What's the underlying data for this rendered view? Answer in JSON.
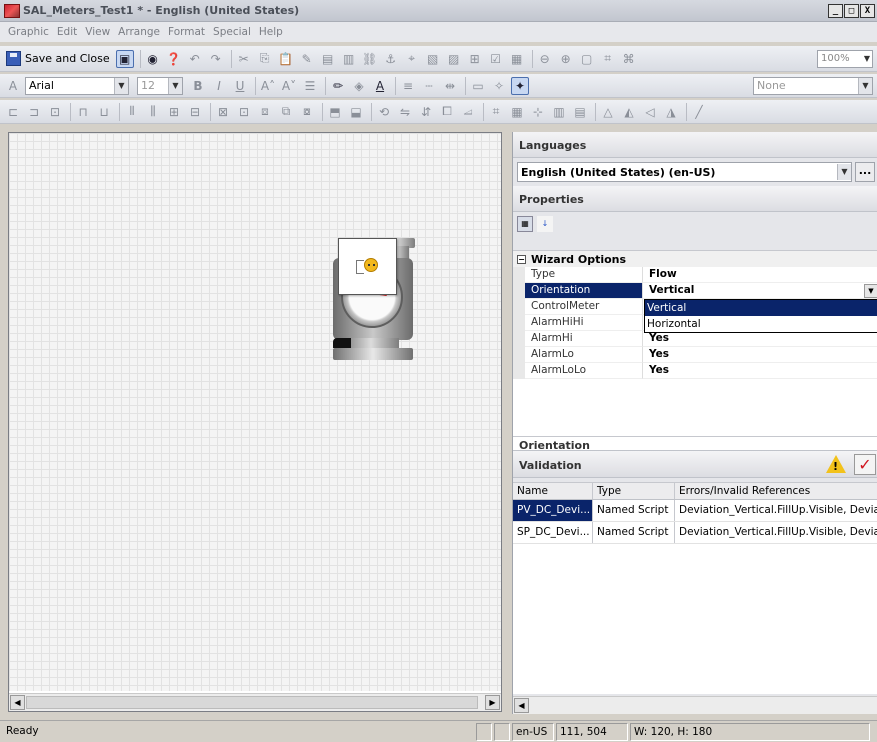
{
  "window": {
    "title": "SAL_Meters_Test1 * - English (United States)",
    "min": "_",
    "max": "□",
    "close": "X"
  },
  "menu": [
    "Graphic",
    "Edit",
    "View",
    "Arrange",
    "Format",
    "Special",
    "Help"
  ],
  "toolbar": {
    "save_close_label": "Save and Close",
    "zoom": "100%",
    "font_name": "Arial",
    "font_size": "12",
    "style_combo": "None"
  },
  "languages": {
    "header": "Languages",
    "selected": "English (United States) (en-US)",
    "ellipsis": "..."
  },
  "properties": {
    "header": "Properties",
    "category": "Wizard Options",
    "rows": [
      {
        "name": "Type",
        "value": "Flow"
      },
      {
        "name": "Orientation",
        "value": "Vertical"
      },
      {
        "name": "ControlMeter",
        "value": ""
      },
      {
        "name": "AlarmHiHi",
        "value": ""
      },
      {
        "name": "AlarmHi",
        "value": "Yes"
      },
      {
        "name": "AlarmLo",
        "value": "Yes"
      },
      {
        "name": "AlarmLoLo",
        "value": "Yes"
      }
    ],
    "dropdown_options": [
      "Vertical",
      "Horizontal"
    ],
    "description_title": "Orientation"
  },
  "validation": {
    "header": "Validation",
    "columns": [
      "Name",
      "Type",
      "Errors/Invalid References"
    ],
    "rows": [
      {
        "name": "PV_DC_Devi...",
        "type": "Named Script",
        "errors": "Deviation_Vertical.FillUp.Visible, Deviation"
      },
      {
        "name": "SP_DC_Devi...",
        "type": "Named Script",
        "errors": "Deviation_Vertical.FillUp.Visible, Deviation"
      }
    ]
  },
  "status": {
    "ready": "Ready",
    "locale": "en-US",
    "coords": "111, 504",
    "size": "W: 120, H: 180"
  }
}
